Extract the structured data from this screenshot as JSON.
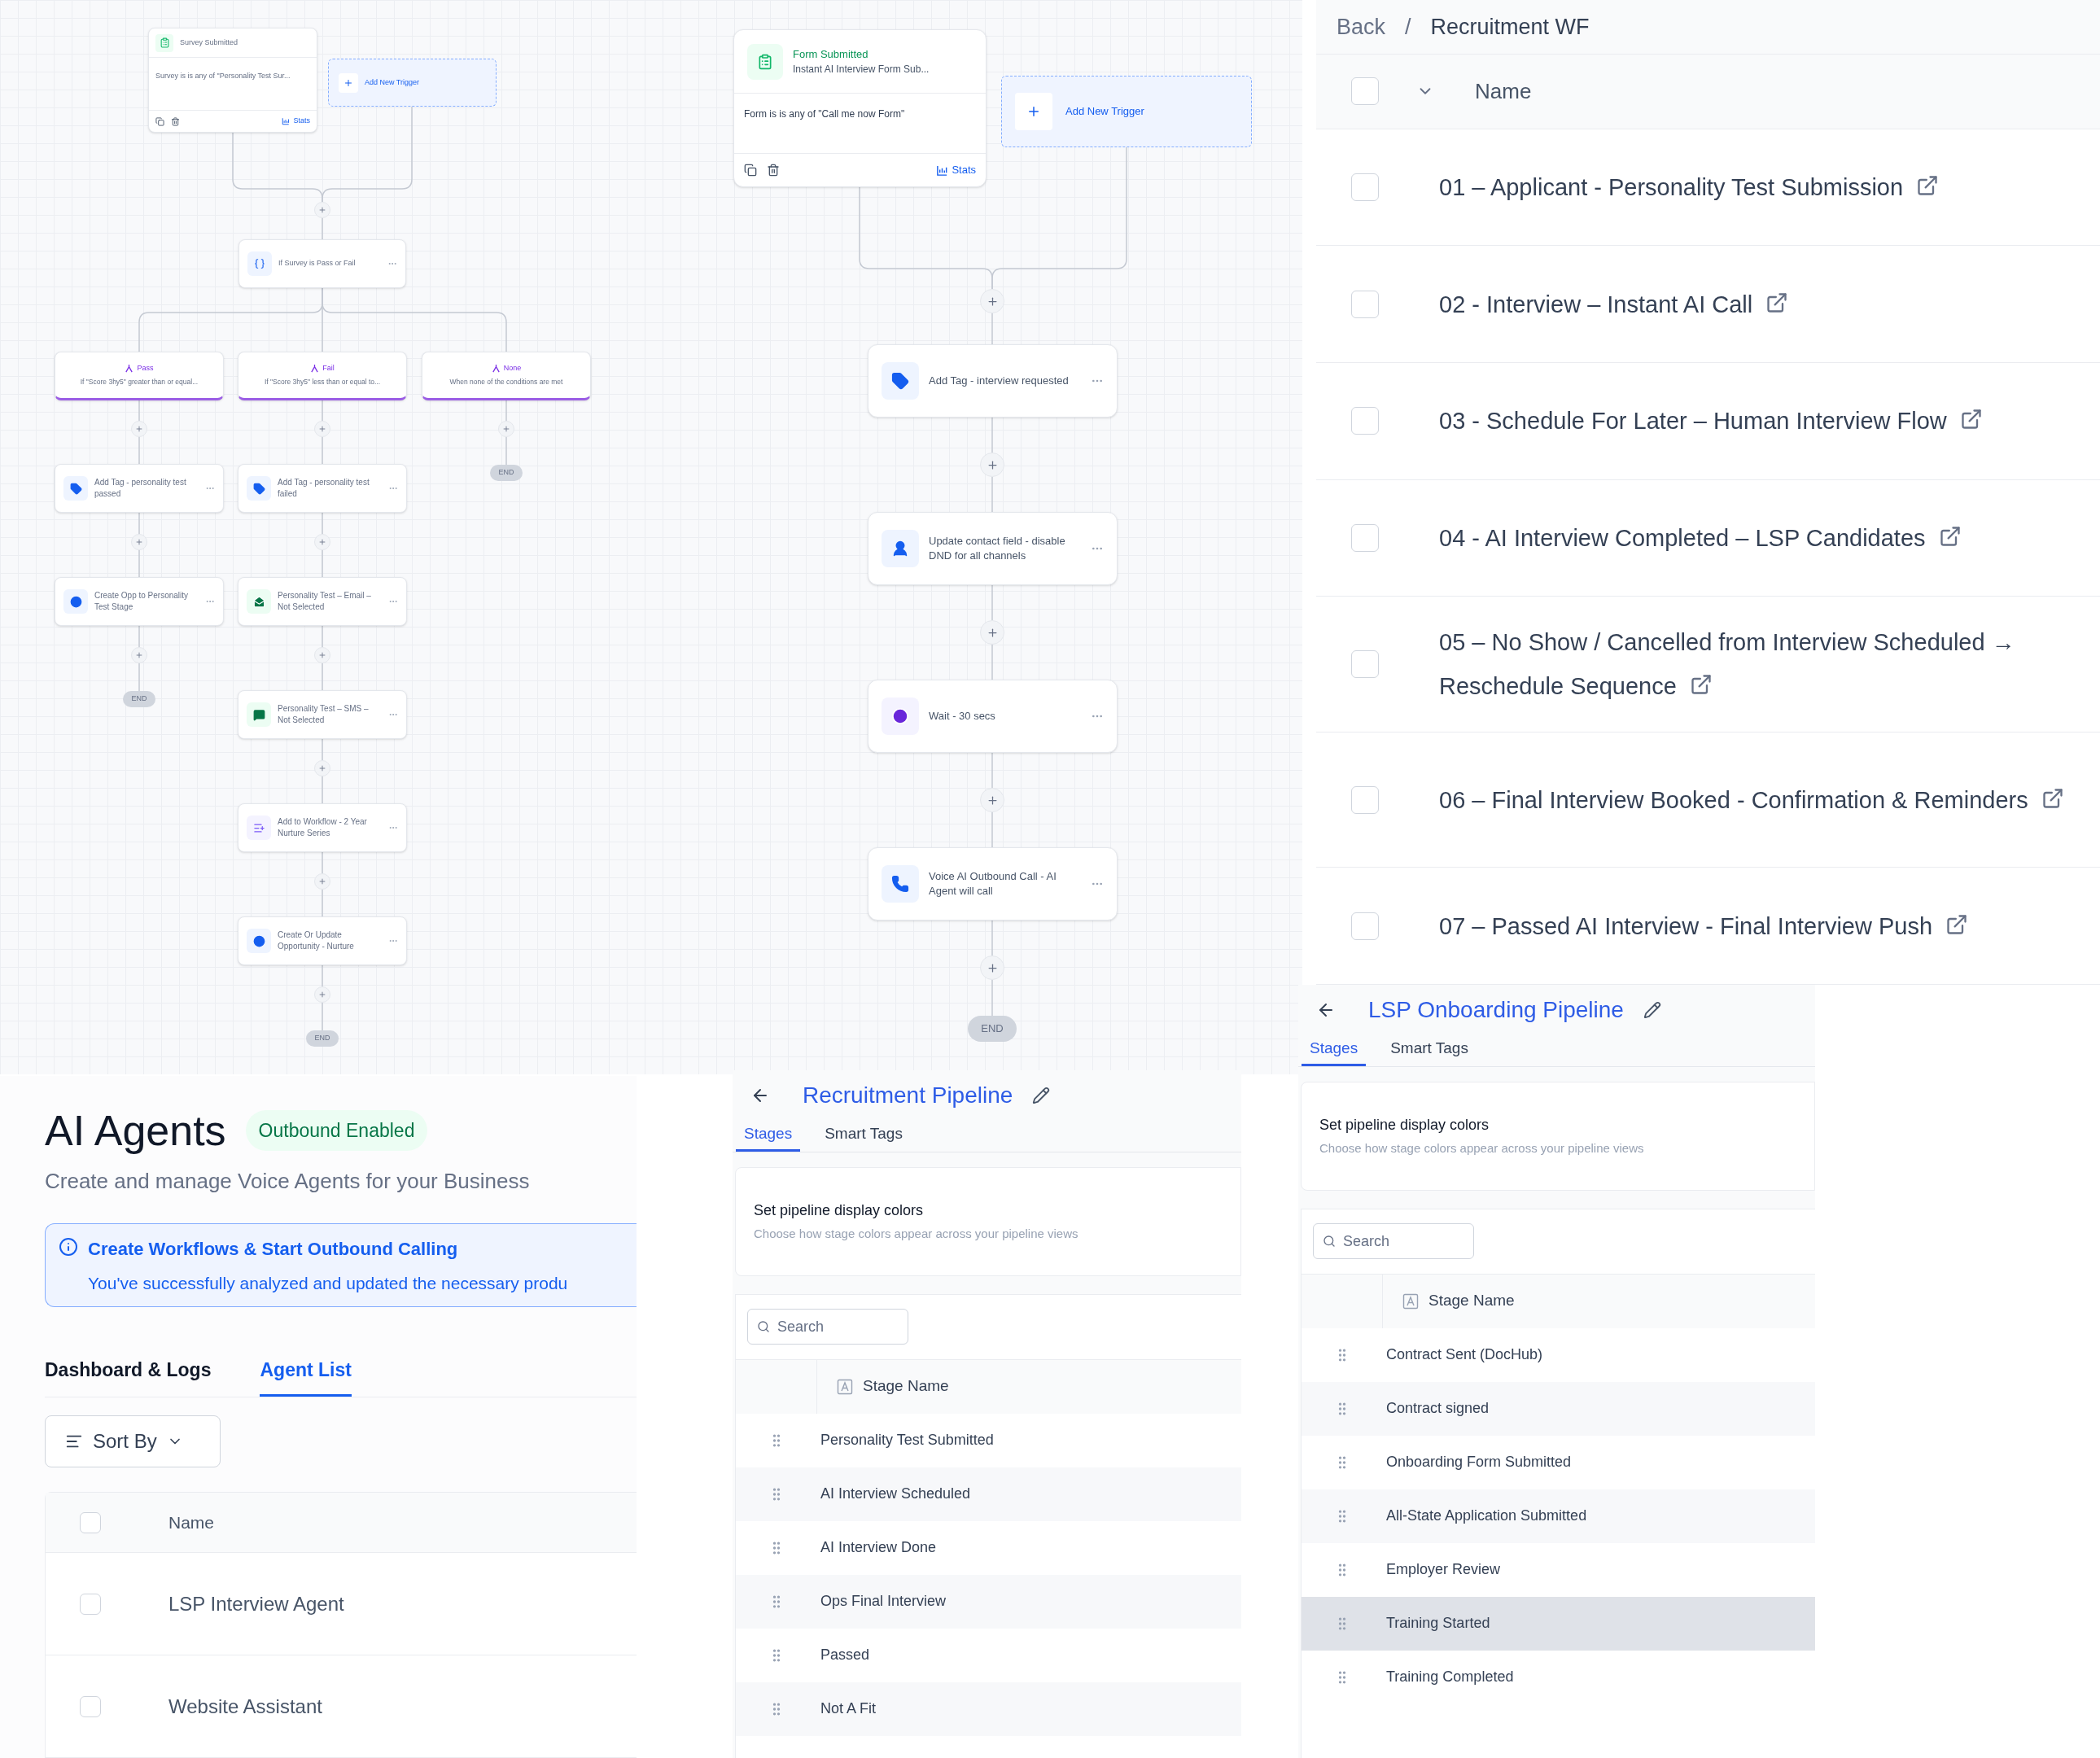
{
  "survey_workflow": {
    "trigger": {
      "title": "Survey Submitted",
      "condition": "Survey is is any of \"Personality Test Sur...",
      "stats": "Stats"
    },
    "add_trigger": "Add New Trigger",
    "condition_node": "If Survey is Pass or Fail",
    "branches": [
      {
        "name": "Pass",
        "description": "If \"Score 3hy5\" greater than or equal...",
        "steps": [
          {
            "kind": "tag",
            "label": "Add Tag - personality test passed"
          },
          {
            "kind": "opportunity",
            "label": "Create Opp to Personality Test Stage"
          }
        ],
        "end": "END"
      },
      {
        "name": "Fail",
        "description": "If \"Score 3hy5\" less than or equal to...",
        "steps": [
          {
            "kind": "tag",
            "label": "Add Tag - personality test failed"
          },
          {
            "kind": "email",
            "label": "Personality Test – Email – Not Selected"
          },
          {
            "kind": "sms",
            "label": "Personality Test – SMS – Not Selected"
          },
          {
            "kind": "workflow",
            "label": "Add to Workflow - 2 Year Nurture Series"
          },
          {
            "kind": "opportunity",
            "label": "Create Or Update Opportunity - Nurture"
          }
        ],
        "end": "END"
      },
      {
        "name": "None",
        "description": "When none of the conditions are met",
        "end": "END"
      }
    ]
  },
  "form_workflow": {
    "trigger": {
      "title": "Form Submitted",
      "subtitle": "Instant AI Interview Form Sub...",
      "condition": "Form is is any of \"Call me now Form\"",
      "stats": "Stats"
    },
    "add_trigger": "Add New Trigger",
    "steps": [
      {
        "kind": "tag",
        "label": "Add Tag - interview requested"
      },
      {
        "kind": "contact",
        "label": "Update contact field - disable DND for all channels"
      },
      {
        "kind": "wait",
        "label": "Wait - 30 secs"
      },
      {
        "kind": "call",
        "label": "Voice AI Outbound Call - AI Agent will call"
      }
    ],
    "end": "END"
  },
  "workflow_list": {
    "breadcrumb": {
      "back": "Back",
      "separator": "/",
      "current": "Recruitment WF"
    },
    "header": {
      "checked": false,
      "column": "Name"
    },
    "rows": [
      {
        "name": "01 – Applicant  - Personality Test Submission",
        "checked": false
      },
      {
        "name": "02  - Interview – Instant AI Call",
        "checked": false
      },
      {
        "name": "03  - Schedule For Later – Human Interview Flow",
        "checked": false
      },
      {
        "name": "04  - AI Interview Completed – LSP Candidates",
        "checked": false
      },
      {
        "name": "05 – No Show / Cancelled from Interview Scheduled → Reschedule Sequence",
        "checked": false
      },
      {
        "name": "06 – Final Interview Booked  - Confirmation & Reminders",
        "checked": false
      },
      {
        "name": "07 – Passed AI Interview  - Final Interview Push",
        "checked": false
      }
    ]
  },
  "ai_agents": {
    "title": "AI Agents",
    "badge": "Outbound Enabled",
    "subtitle": "Create and manage Voice Agents for your Business",
    "alert": {
      "title": "Create Workflows & Start Outbound Calling",
      "message": "You've successfully analyzed and updated the necessary produ"
    },
    "tabs": [
      {
        "label": "Dashboard & Logs",
        "selected": false
      },
      {
        "label": "Agent List",
        "selected": true
      }
    ],
    "sort_button": "Sort By",
    "header": {
      "checked": false,
      "column": "Name"
    },
    "rows": [
      {
        "name": "LSP Interview Agent",
        "checked": false
      },
      {
        "name": "Website Assistant",
        "checked": false
      }
    ]
  },
  "recruitment_pipeline": {
    "title": "Recruitment Pipeline",
    "tabs": [
      {
        "label": "Stages",
        "selected": true
      },
      {
        "label": "Smart Tags",
        "selected": false
      }
    ],
    "display_colors": {
      "title": "Set pipeline display colors",
      "description": "Choose how stage colors appear across your pipeline views"
    },
    "search": {
      "placeholder": "Search"
    },
    "column": "Stage Name",
    "stages": [
      {
        "name": "Personality Test Submitted",
        "hovered": false
      },
      {
        "name": "AI Interview Scheduled",
        "hovered": false
      },
      {
        "name": "AI Interview Done",
        "hovered": false
      },
      {
        "name": "Ops Final Interview",
        "hovered": false
      },
      {
        "name": "Passed",
        "hovered": false
      },
      {
        "name": "Not A Fit",
        "hovered": false
      }
    ]
  },
  "lsp_pipeline": {
    "title": "LSP Onboarding Pipeline",
    "tabs": [
      {
        "label": "Stages",
        "selected": true
      },
      {
        "label": "Smart Tags",
        "selected": false
      }
    ],
    "display_colors": {
      "title": "Set pipeline display colors",
      "description": "Choose how stage colors appear across your pipeline views"
    },
    "search": {
      "placeholder": "Search"
    },
    "column": "Stage Name",
    "stages": [
      {
        "name": "Contract Sent (DocHub)",
        "hovered": false
      },
      {
        "name": "Contract signed",
        "hovered": false
      },
      {
        "name": "Onboarding Form Submitted",
        "hovered": false
      },
      {
        "name": "All-State Application Submitted",
        "hovered": false
      },
      {
        "name": "Employer Review",
        "hovered": false
      },
      {
        "name": "Training Started",
        "hovered": true
      },
      {
        "name": "Training Completed",
        "hovered": false
      }
    ]
  }
}
